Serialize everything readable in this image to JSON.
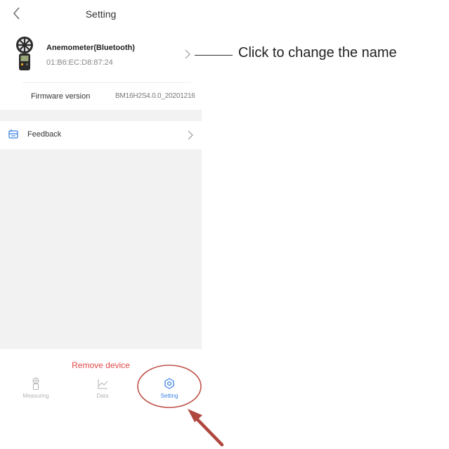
{
  "header": {
    "title": "Setting"
  },
  "device": {
    "name": "Anemometer(Bluetooth)",
    "mac": "01:B6:EC:D8:87:24"
  },
  "firmware": {
    "label": "Firmware version",
    "value": "BM16H2S4.0.0_20201216"
  },
  "feedback": {
    "label": "Feedback"
  },
  "remove": {
    "label": "Remove device"
  },
  "tabs": [
    {
      "label": "Measuring",
      "icon": "anemometer-icon",
      "active": false
    },
    {
      "label": "Data",
      "icon": "line-chart-icon",
      "active": false
    },
    {
      "label": "Setting",
      "icon": "gear-icon",
      "active": true
    }
  ],
  "annotation": {
    "text": "Click to change the name"
  },
  "colors": {
    "accent": "#3a82e6",
    "danger": "#e04848",
    "annotation": "#c0524a"
  }
}
